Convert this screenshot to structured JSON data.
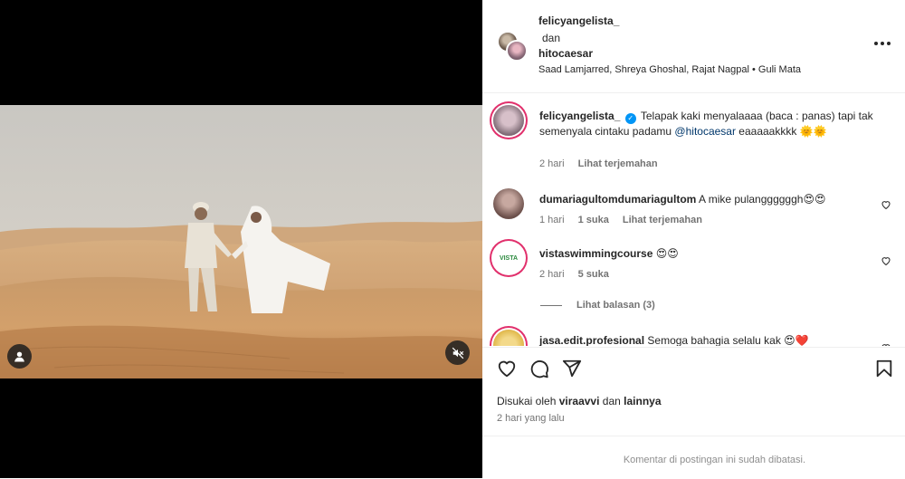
{
  "post": {
    "author1": "felicyangelista_",
    "connector": "dan",
    "author2": "hitocaesar",
    "audio": "Saad Lamjarred, Shreya Ghoshal, Rajat Nagpal • Guli Mata"
  },
  "caption": {
    "user": "felicyangelista_",
    "text_before": "Telapak kaki menyalaaaa (baca : panas) tapi tak semenyala cintaku padamu ",
    "mention": "@hitocaesar",
    "text_after": " eaaaaakkkk 🌞🌞",
    "time": "2 hari",
    "translate": "Lihat terjemahan"
  },
  "comments": [
    {
      "user": "dumariagultomdumariagultom",
      "text": "A mike pulanggggggh😍😍",
      "time": "1 hari",
      "likes": "1 suka",
      "translate": "Lihat terjemahan"
    },
    {
      "user": "vistaswimmingcourse",
      "text": "😍😍",
      "time": "2 hari",
      "likes": "5 suka",
      "view_replies": "Lihat balasan (3)",
      "avatar_text": "VISTA"
    },
    {
      "user": "jasa.edit.profesional",
      "text": "Semoga bahagia selalu kak 😍❤️"
    }
  ],
  "actions": {
    "like_icon": "heart-icon",
    "comment_icon": "comment-icon",
    "share_icon": "share-icon",
    "save_icon": "bookmark-icon"
  },
  "likes": {
    "prefix": "Disukai oleh",
    "user": "viraavvi",
    "middle": "dan",
    "others": "lainnya"
  },
  "date": "2 hari yang lalu",
  "comments_limited": "Komentar di postingan ini sudah dibatasi.",
  "colors": {
    "link": "#00376b",
    "verified": "#0095f6",
    "muted": "#737373"
  }
}
